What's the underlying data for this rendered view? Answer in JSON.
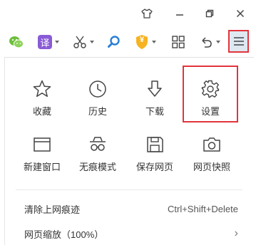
{
  "titlebar": {
    "icons": [
      "shirt-icon",
      "minimize-icon",
      "restore-icon",
      "close-icon"
    ]
  },
  "toolbar": {
    "translate_label": "译",
    "shield_glyph": "¥",
    "icons": [
      "wechat-icon",
      "translate-icon",
      "scissors-icon",
      "search-icon",
      "security-shield-icon",
      "apps-grid-icon",
      "undo-icon",
      "menu-icon"
    ],
    "colors": {
      "wechat": "#6ebf3b",
      "translate": "#8a5bd6",
      "search": "#2a7fd4",
      "shield": "#f6b322",
      "highlight": "#e2343c"
    }
  },
  "menu": {
    "grid": [
      {
        "label": "收藏",
        "icon": "star-icon"
      },
      {
        "label": "历史",
        "icon": "clock-icon"
      },
      {
        "label": "下载",
        "icon": "download-arrow-icon"
      },
      {
        "label": "设置",
        "icon": "gear-icon"
      },
      {
        "label": "新建窗口",
        "icon": "new-window-icon"
      },
      {
        "label": "无痕模式",
        "icon": "incognito-icon"
      },
      {
        "label": "保存网页",
        "icon": "save-disk-icon"
      },
      {
        "label": "网页快照",
        "icon": "camera-icon"
      }
    ],
    "clear_trace": {
      "label": "清除上网痕迹",
      "shortcut": "Ctrl+Shift+Delete"
    },
    "zoom": {
      "label": "网页缩放（100%）",
      "arrow": "›"
    }
  }
}
